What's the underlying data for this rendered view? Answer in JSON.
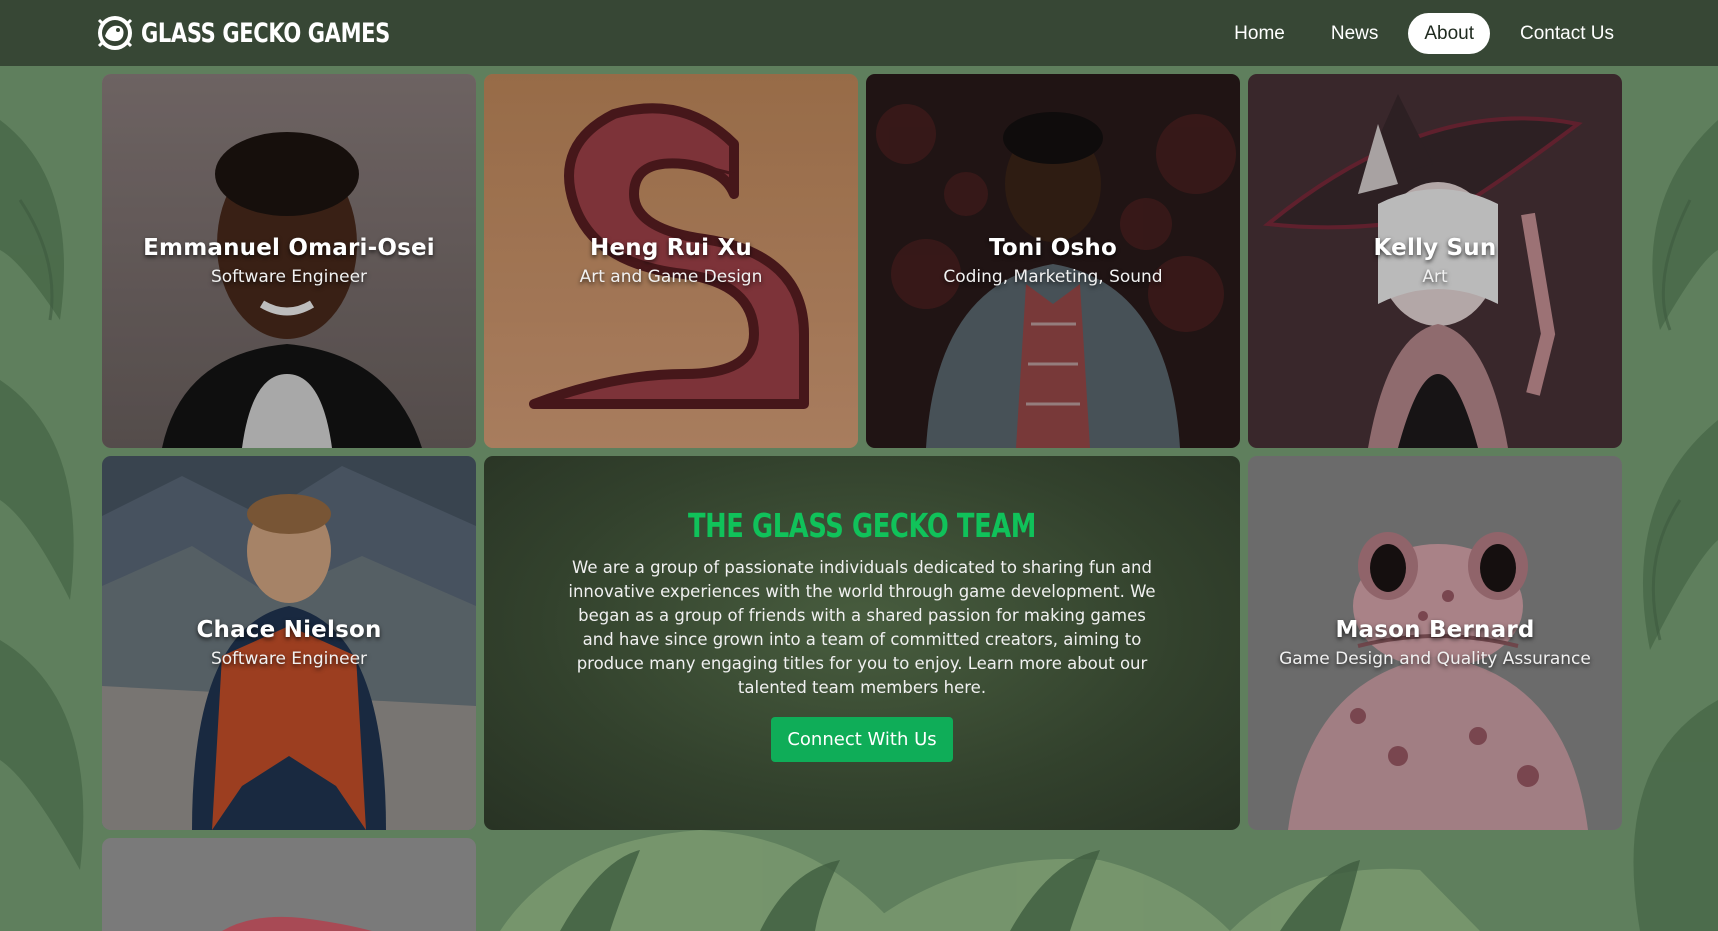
{
  "brand": {
    "name": "GLASS GECKO GAMES",
    "logo_icon": "gecko-logo-icon"
  },
  "nav": {
    "items": [
      {
        "label": "Home",
        "active": false
      },
      {
        "label": "News",
        "active": false
      },
      {
        "label": "About",
        "active": true
      },
      {
        "label": "Contact Us",
        "active": false
      }
    ]
  },
  "team": [
    {
      "name": "Emmanuel Omari-Osei",
      "role": "Software Engineer",
      "image": "portrait-photo"
    },
    {
      "name": "Heng Rui Xu",
      "role": "Art and Game Design",
      "image": "serpent-illustration"
    },
    {
      "name": "Toni Osho",
      "role": "Coding, Marketing, Sound",
      "image": "portrait-photo"
    },
    {
      "name": "Kelly Sun",
      "role": "Art",
      "image": "witch-illustration"
    },
    {
      "name": "Chace Nielson",
      "role": "Software Engineer",
      "image": "mountain-portrait-photo"
    },
    {
      "name": "Mason Bernard",
      "role": "Game Design and Quality Assurance",
      "image": "frog-illustration"
    }
  ],
  "about": {
    "title": "THE GLASS GECKO TEAM",
    "description": "We are a group of passionate individuals dedicated to sharing fun and innovative experiences with the world through game development. We began as a group of friends with a shared passion for making games and have since grown into a team of committed creators, aiming to produce many engaging titles for you to enjoy. Learn more about our talented team members here.",
    "button_label": "Connect With Us"
  },
  "colors": {
    "accent_green": "#10c25a",
    "button_green": "#0fad58",
    "nav_bg": "#344232",
    "page_bg": "#5e7d5c"
  }
}
